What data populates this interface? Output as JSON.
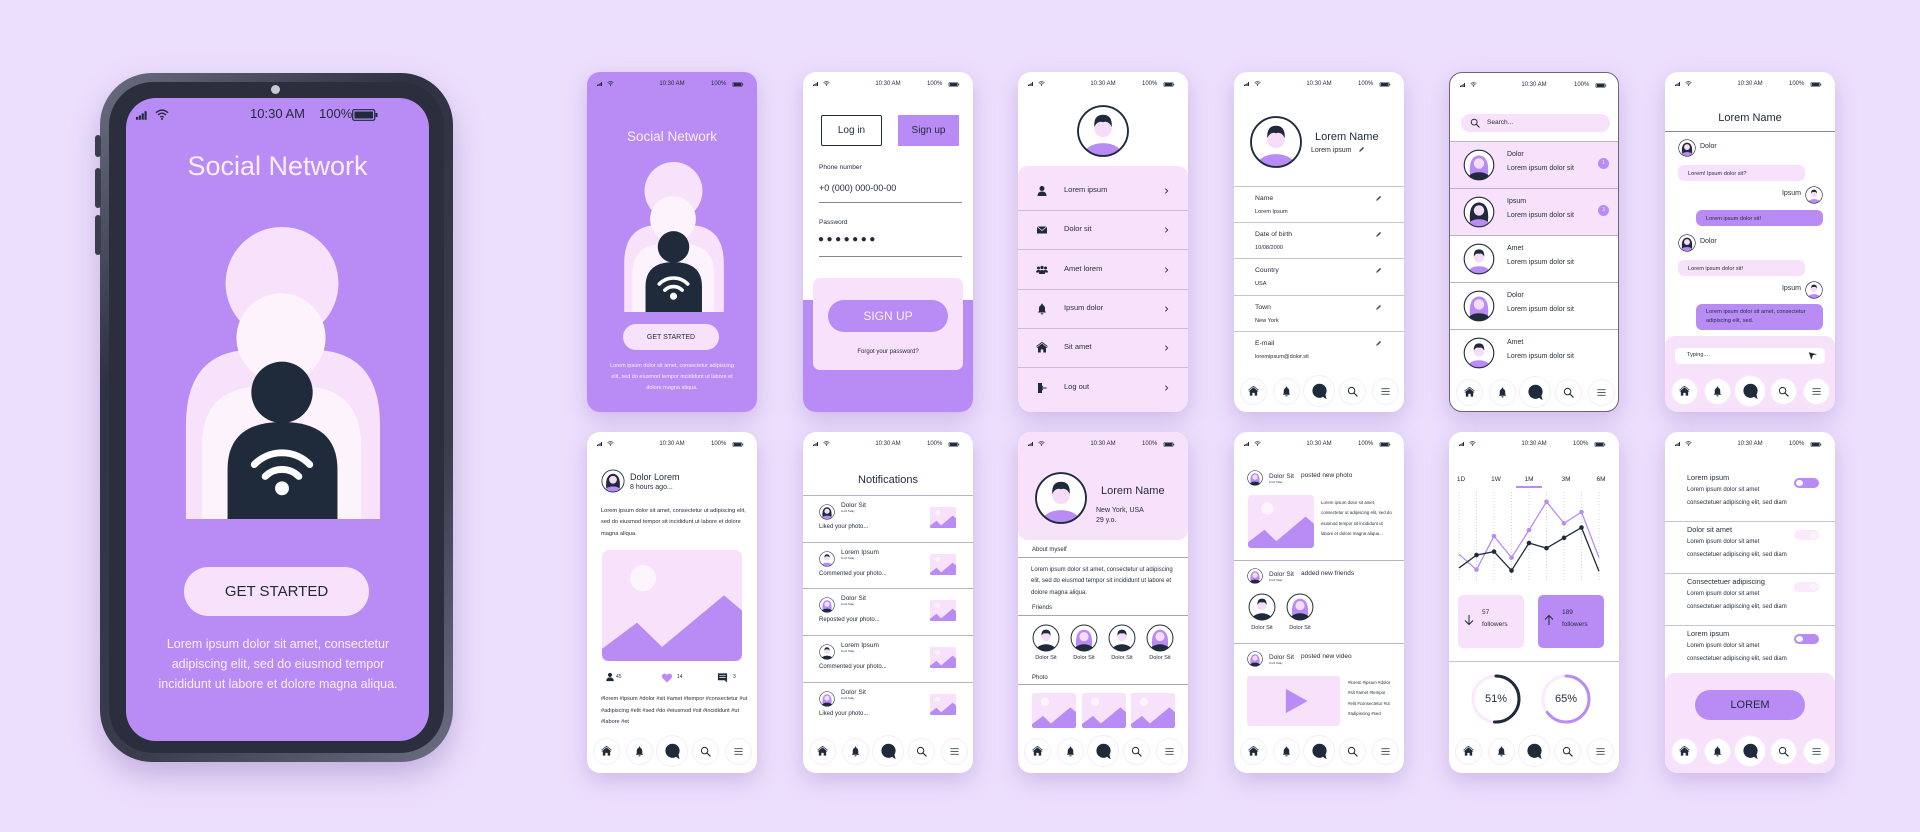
{
  "status": {
    "time": "10:30 AM",
    "battery": "100%"
  },
  "colors": {
    "background": "#ecdffc",
    "purple": "#b98cf5",
    "light_pink": "#f8e1fb",
    "dark": "#1f2a3a"
  },
  "nav": {
    "icons": [
      "home-icon",
      "bell-icon",
      "chat-icon",
      "search-icon",
      "menu-icon"
    ]
  },
  "hero": {
    "title": "Social Network",
    "button": "GET STARTED",
    "text": "Lorem ipsum dolor sit amet, consectetur adipiscing elit, sed do eiusmod tempor incididunt ut labore et dolore magna aliqua."
  },
  "login": {
    "login_tab": "Log in",
    "signup_tab": "Sign up",
    "phone_label": "Phone number",
    "phone_value": "+0 (000) 000-00-00",
    "password_label": "Password",
    "password_value": "●●●●●●●",
    "submit": "SIGN UP",
    "forgot": "Forgot your password?"
  },
  "menu": {
    "items": [
      {
        "icon": "user-icon",
        "label": "Lorem ipsum"
      },
      {
        "icon": "mail-icon",
        "label": "Dolor sit"
      },
      {
        "icon": "group-icon",
        "label": "Amet lorem"
      },
      {
        "icon": "bell-icon",
        "label": "Ipsum dolor"
      },
      {
        "icon": "home-icon",
        "label": "Sit amet"
      },
      {
        "icon": "logout-icon",
        "label": "Log out"
      }
    ]
  },
  "profile_edit": {
    "name": "Lorem Name",
    "subtitle": "Lorem ipsum",
    "fields": [
      {
        "label": "Name",
        "value": "Lorem Ipsum"
      },
      {
        "label": "Date of birth",
        "value": "10/08/2000"
      },
      {
        "label": "Country",
        "value": "USA"
      },
      {
        "label": "Town",
        "value": "New York"
      },
      {
        "label": "E-mail",
        "value": "loremipsum@dolor.sit"
      }
    ]
  },
  "chats": {
    "search_placeholder": "Search...",
    "items": [
      {
        "name": "Dolor",
        "message": "Lorem ipsum dolor sit",
        "badge": "1",
        "unread": true
      },
      {
        "name": "Ipsum",
        "message": "Lorem ipsum dolor sit",
        "badge": "3",
        "unread": true
      },
      {
        "name": "Amet",
        "message": "Lorem ipsum dolor sit",
        "unread": false
      },
      {
        "name": "Dolor",
        "message": "Lorem ipsum dolor sit",
        "unread": false
      },
      {
        "name": "Amet",
        "message": "Lorem ipsum dolor sit",
        "unread": false
      }
    ]
  },
  "conversation": {
    "title": "Lorem Name",
    "messages": [
      {
        "from": "Dolor",
        "side": "left",
        "text": "Lorem! Ipsum dolor sit?"
      },
      {
        "from": "Ipsum",
        "side": "right",
        "text": "Lorem ipsum dolor sit!"
      },
      {
        "from": "Dolor",
        "side": "left",
        "text": "Lorem ipsum dolor sit!"
      },
      {
        "from": "Ipsum",
        "side": "right",
        "text": "Lorem ipsum dolor sit amet, consectetur adipiscing elit, sed."
      }
    ],
    "input_placeholder": "Typing..."
  },
  "post": {
    "author": "Dolor Lorem",
    "time": "8 hours ago...",
    "text": "Lorem ipsum dolor sit amet, consectetur ut adipiscing elit, sed do eiusmod tempor sit incididunt ut labore et dolore magna aliqua.",
    "followers": "45",
    "likes": "14",
    "comments": "3",
    "tags": "#lorem #ipsum #dolor #sit #amet #tempor #consectetur #ut #adipiscing #elit #sed #do #eiusmod #sit #incididunt #ut #labore #et"
  },
  "notifications": {
    "title": "Notifications",
    "items": [
      {
        "name": "Dolor Sit",
        "time": "11:24 Today",
        "action": "Liked your photo..."
      },
      {
        "name": "Lorem Ipsum",
        "time": "11:24 Today",
        "action": "Commented your photo..."
      },
      {
        "name": "Dolor Sit",
        "time": "11:24 Today",
        "action": "Reposted your photo..."
      },
      {
        "name": "Lorem Ipsum",
        "time": "11:24 Today",
        "action": "Commented your photo..."
      },
      {
        "name": "Dolor Sit",
        "time": "11:24 Today",
        "action": "Liked your photo..."
      }
    ]
  },
  "user_profile": {
    "name": "Lorem Name",
    "location": "New York, USA",
    "age": "29 y.o.",
    "about_label": "About myself",
    "about": "Lorem ipsum dolor sit amet, consectetur ut adipiscing elit, sed do eiusmod tempor sit incididunt ut labore et dolore magna aliqua.",
    "friends_label": "Friends",
    "friends": [
      "Dolor Sit",
      "Dolor Sit",
      "Dolor Sit",
      "Dolor Sit"
    ],
    "photo_label": "Photo"
  },
  "feed": {
    "items": [
      {
        "name": "Dolor Sit",
        "time": "11:24 Today",
        "action": "posted new photo",
        "text": "Lorem ipsum dolor sit amet, consectetur ut adipiscing elit, sed do eiusmod tempor sit incididunt ut labore et dolore magna aliqua..."
      },
      {
        "name": "Dolor Sit",
        "time": "11:24 Today",
        "action": "added new friends",
        "friends": [
          "Dolor Sit",
          "Dolor Sit"
        ]
      },
      {
        "name": "Dolor Sit",
        "time": "11:24 Today",
        "action": "posted new video",
        "tags": "#lorem #ipsum #dolor #sit #amet #tempor #elit #consectetur #ut #adipiscing #sed"
      }
    ]
  },
  "stats": {
    "ranges": [
      "1D",
      "1W",
      "1M",
      "3M",
      "6M"
    ],
    "selected_range": "1M",
    "down": {
      "value": "57",
      "label": "followers"
    },
    "up": {
      "value": "189",
      "label": "followers"
    },
    "gauges": [
      {
        "label": "51%",
        "value": 51,
        "color": "#1f2a3a"
      },
      {
        "label": "65%",
        "value": 65,
        "color": "#b98cf5"
      }
    ]
  },
  "chart_data": {
    "type": "line",
    "x": [
      1,
      2,
      3,
      4,
      5,
      6,
      7,
      8,
      9
    ],
    "ylim": [
      0,
      100
    ],
    "grid": "vertical dotted",
    "series": [
      {
        "color": "#b98cf5",
        "values": [
          30,
          12,
          51,
          26,
          58,
          91,
          66,
          79,
          26
        ]
      },
      {
        "color": "#1f2a3a",
        "values": [
          14,
          29,
          33,
          11,
          43,
          37,
          49,
          61,
          10
        ]
      }
    ]
  },
  "settings": {
    "items": [
      {
        "title": "Lorem ipsum",
        "desc1": "Lorem ipsum dolor sit amet",
        "desc2": "consectetuer adipiscing elit, sed diam",
        "on": true
      },
      {
        "title": "Dolor sit amet",
        "desc1": "Lorem ipsum dolor sit amet",
        "desc2": "consectetuer adipiscing elit, sed diam",
        "on": false
      },
      {
        "title": "Consectetuer adipiscing",
        "desc1": "Lorem ipsum dolor sit amet",
        "desc2": "consectetuer adipiscing elit, sed diam",
        "on": false
      },
      {
        "title": "Lorem ipsum",
        "desc1": "Lorem ipsum dolor sit amet",
        "desc2": "consectetuer adipiscing elit, sed diam",
        "on": true
      }
    ],
    "button": "LOREM"
  }
}
